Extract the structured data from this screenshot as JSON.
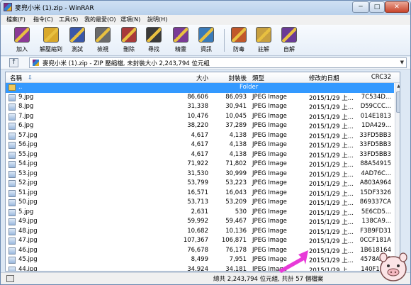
{
  "window": {
    "title": "麥兜小米 (1).zip - WinRAR",
    "min": "─",
    "max": "□",
    "close": "✕"
  },
  "menu": [
    "檔案(F)",
    "指令(C)",
    "工具(S)",
    "我的最愛(O)",
    "選項(N)",
    "說明(H)"
  ],
  "toolbar": [
    {
      "label": "加入",
      "icon": "books-add-icon",
      "color": "#8b3a96"
    },
    {
      "label": "解壓縮到",
      "icon": "folder-extract-icon",
      "color": "#d9a82b"
    },
    {
      "label": "測試",
      "icon": "test-check-icon",
      "color": "#3a57a8"
    },
    {
      "label": "檢視",
      "icon": "glasses-view-icon",
      "color": "#6b6b6b"
    },
    {
      "label": "刪除",
      "icon": "delete-books-icon",
      "color": "#a83a3a"
    },
    {
      "label": "尋找",
      "icon": "binoculars-find-icon",
      "color": "#3a3a3a"
    },
    {
      "label": "精靈",
      "icon": "wizard-icon",
      "color": "#7a3a96"
    },
    {
      "label": "資訊",
      "icon": "info-icon",
      "color": "#3a7ab8"
    },
    {
      "label": "防毒",
      "icon": "antivirus-icon",
      "color": "#c0572a"
    },
    {
      "label": "註解",
      "icon": "comment-pencil-icon",
      "color": "#c8a040"
    },
    {
      "label": "自解",
      "icon": "sfx-icon",
      "color": "#6a3a96"
    }
  ],
  "address": {
    "text": "麥兜小米 (1).zip - ZIP 壓縮檔, 未封裝大小 2,243,794 位元組"
  },
  "columns": {
    "name": "名稱",
    "size": "大小",
    "packed": "封裝後",
    "type": "類型",
    "modified": "修改的日期",
    "crc": "CRC32"
  },
  "folder_row": {
    "name": "..",
    "type": "Folder"
  },
  "files": [
    {
      "name": "9.jpg",
      "size": "86,606",
      "packed": "86,093",
      "type": "JPEG Image",
      "modified": "2015/1/29 上...",
      "crc": "7C534D..."
    },
    {
      "name": "8.jpg",
      "size": "31,338",
      "packed": "30,941",
      "type": "JPEG Image",
      "modified": "2015/1/29 上...",
      "crc": "D59CCC..."
    },
    {
      "name": "7.jpg",
      "size": "10,476",
      "packed": "10,045",
      "type": "JPEG Image",
      "modified": "2015/1/29 上...",
      "crc": "014E1813"
    },
    {
      "name": "6.jpg",
      "size": "38,220",
      "packed": "37,289",
      "type": "JPEG Image",
      "modified": "2015/1/29 上...",
      "crc": "1DA429..."
    },
    {
      "name": "57.jpg",
      "size": "4,617",
      "packed": "4,138",
      "type": "JPEG Image",
      "modified": "2015/1/29 上...",
      "crc": "33FD5BB3"
    },
    {
      "name": "56.jpg",
      "size": "4,617",
      "packed": "4,138",
      "type": "JPEG Image",
      "modified": "2015/1/29 上...",
      "crc": "33FD5BB3"
    },
    {
      "name": "55.jpg",
      "size": "4,617",
      "packed": "4,138",
      "type": "JPEG Image",
      "modified": "2015/1/29 上...",
      "crc": "33FD5BB3"
    },
    {
      "name": "54.jpg",
      "size": "71,922",
      "packed": "71,802",
      "type": "JPEG Image",
      "modified": "2015/1/29 上...",
      "crc": "88A54915"
    },
    {
      "name": "53.jpg",
      "size": "31,530",
      "packed": "30,999",
      "type": "JPEG Image",
      "modified": "2015/1/29 上...",
      "crc": "4AD76C..."
    },
    {
      "name": "52.jpg",
      "size": "53,799",
      "packed": "53,223",
      "type": "JPEG Image",
      "modified": "2015/1/29 上...",
      "crc": "A803A964"
    },
    {
      "name": "51.jpg",
      "size": "16,571",
      "packed": "16,043",
      "type": "JPEG Image",
      "modified": "2015/1/29 上...",
      "crc": "15DF3326"
    },
    {
      "name": "50.jpg",
      "size": "53,713",
      "packed": "53,209",
      "type": "JPEG Image",
      "modified": "2015/1/29 上...",
      "crc": "869337CA"
    },
    {
      "name": "5.jpg",
      "size": "2,631",
      "packed": "530",
      "type": "JPEG Image",
      "modified": "2015/1/29 上...",
      "crc": "5E6CD5..."
    },
    {
      "name": "49.jpg",
      "size": "59,992",
      "packed": "59,467",
      "type": "JPEG Image",
      "modified": "2015/1/29 上...",
      "crc": "138CA9..."
    },
    {
      "name": "48.jpg",
      "size": "10,682",
      "packed": "10,136",
      "type": "JPEG Image",
      "modified": "2015/1/29 上...",
      "crc": "F3B9FD31"
    },
    {
      "name": "47.jpg",
      "size": "107,367",
      "packed": "106,871",
      "type": "JPEG Image",
      "modified": "2015/1/29 上...",
      "crc": "0CCF181A"
    },
    {
      "name": "46.jpg",
      "size": "76,678",
      "packed": "76,178",
      "type": "JPEG Image",
      "modified": "2015/1/29 上...",
      "crc": "1B618164"
    },
    {
      "name": "45.jpg",
      "size": "8,499",
      "packed": "7,951",
      "type": "JPEG Image",
      "modified": "2015/1/29 上...",
      "crc": "4578AE98"
    },
    {
      "name": "44.jpg",
      "size": "34,924",
      "packed": "34,181",
      "type": "JPEG Image",
      "modified": "2015/1/29 上...",
      "crc": "140F1280"
    }
  ],
  "status": {
    "text": "總共 2,243,794 位元組, 共計 57 個檔案"
  }
}
